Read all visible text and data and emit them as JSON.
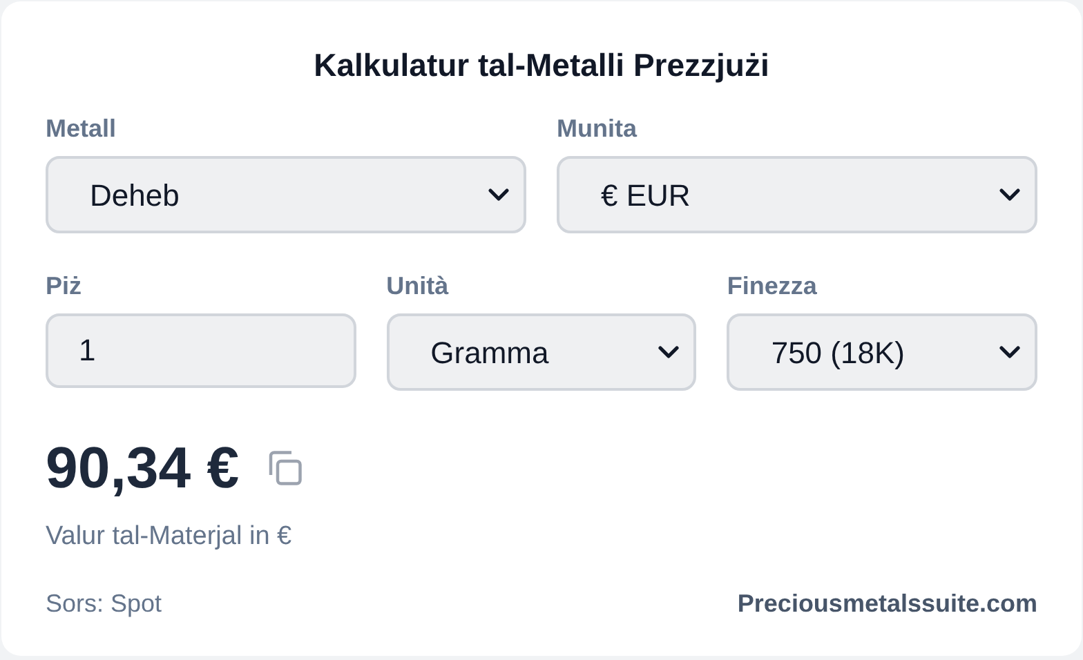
{
  "title": "Kalkulatur tal-Metalli Prezzjużi",
  "row_1": [
    {
      "label": "Metall",
      "kind": "select",
      "value": "Deheb"
    },
    {
      "label": "Munita",
      "kind": "select",
      "value": "€ EUR"
    }
  ],
  "row_2": [
    {
      "label": "Piż",
      "kind": "input",
      "value": "1"
    },
    {
      "label": "Unità",
      "kind": "select",
      "value": "Gramma"
    },
    {
      "label": "Finezza",
      "kind": "select",
      "value": "750 (18K)"
    }
  ],
  "result": {
    "price": "90,34 €",
    "caption": "Valur tal-Materjal in €"
  },
  "footer": {
    "source": "Sors: Spot",
    "link": "Preciousmetalssuite.com"
  }
}
